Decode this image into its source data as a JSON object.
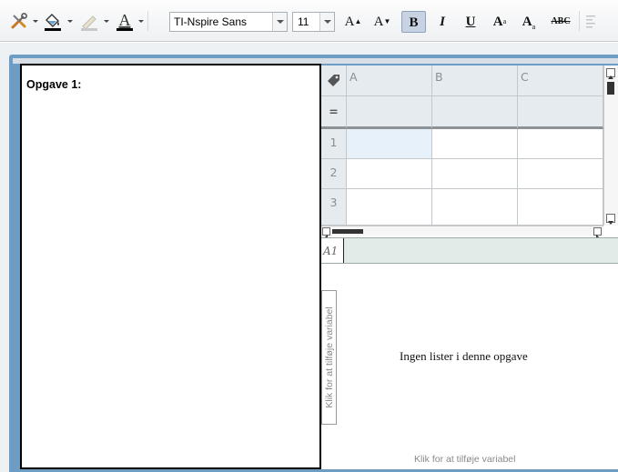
{
  "toolbar": {
    "font_name": "TI-Nspire Sans",
    "font_size": "11",
    "increase_font_label": "A",
    "decrease_font_label": "A",
    "bold_label": "B",
    "italic_label": "I",
    "underline_label": "U",
    "superscript_label": "A",
    "subscript_label": "A",
    "strike_label": "ABC",
    "icons": [
      "tools-icon",
      "fill-color-icon",
      "line-color-icon",
      "text-color-icon",
      "align-icon"
    ],
    "colors": {
      "bold_active": "#c7d3e2",
      "frame": "#6d9cc4"
    }
  },
  "left_pane": {
    "title": "Opgave 1:"
  },
  "spreadsheet": {
    "columns": [
      "A",
      "B",
      "C"
    ],
    "formula_row_label": "=",
    "rows": [
      "1",
      "2",
      "3"
    ],
    "selected_cell": "A1",
    "cell_reference": "A1"
  },
  "lists": {
    "empty_message": "Ingen lister i denne opgave",
    "add_variable_vertical": "Klik for at tilføje variabel",
    "add_variable_bottom": "Klik for at tilføje variabel"
  }
}
